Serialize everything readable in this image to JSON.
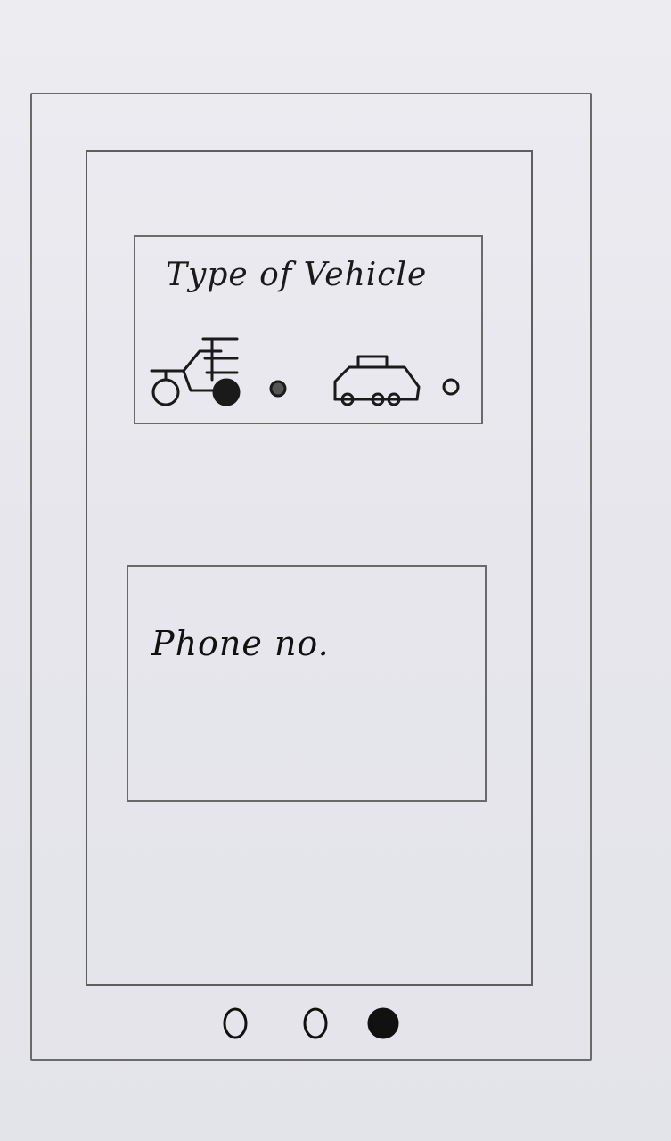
{
  "vehicle_section": {
    "title": "Type of Vehicle",
    "options": [
      {
        "icon": "motorcycle-icon",
        "selected": true
      },
      {
        "icon": "car-icon",
        "selected": false
      }
    ]
  },
  "phone_section": {
    "label": "Phone no."
  },
  "pager": {
    "total": 3,
    "active_index": 2
  },
  "colors": {
    "ink": "#1a1a1a",
    "pencil": "#6a6a6a",
    "paper": "#e9e9ee"
  }
}
